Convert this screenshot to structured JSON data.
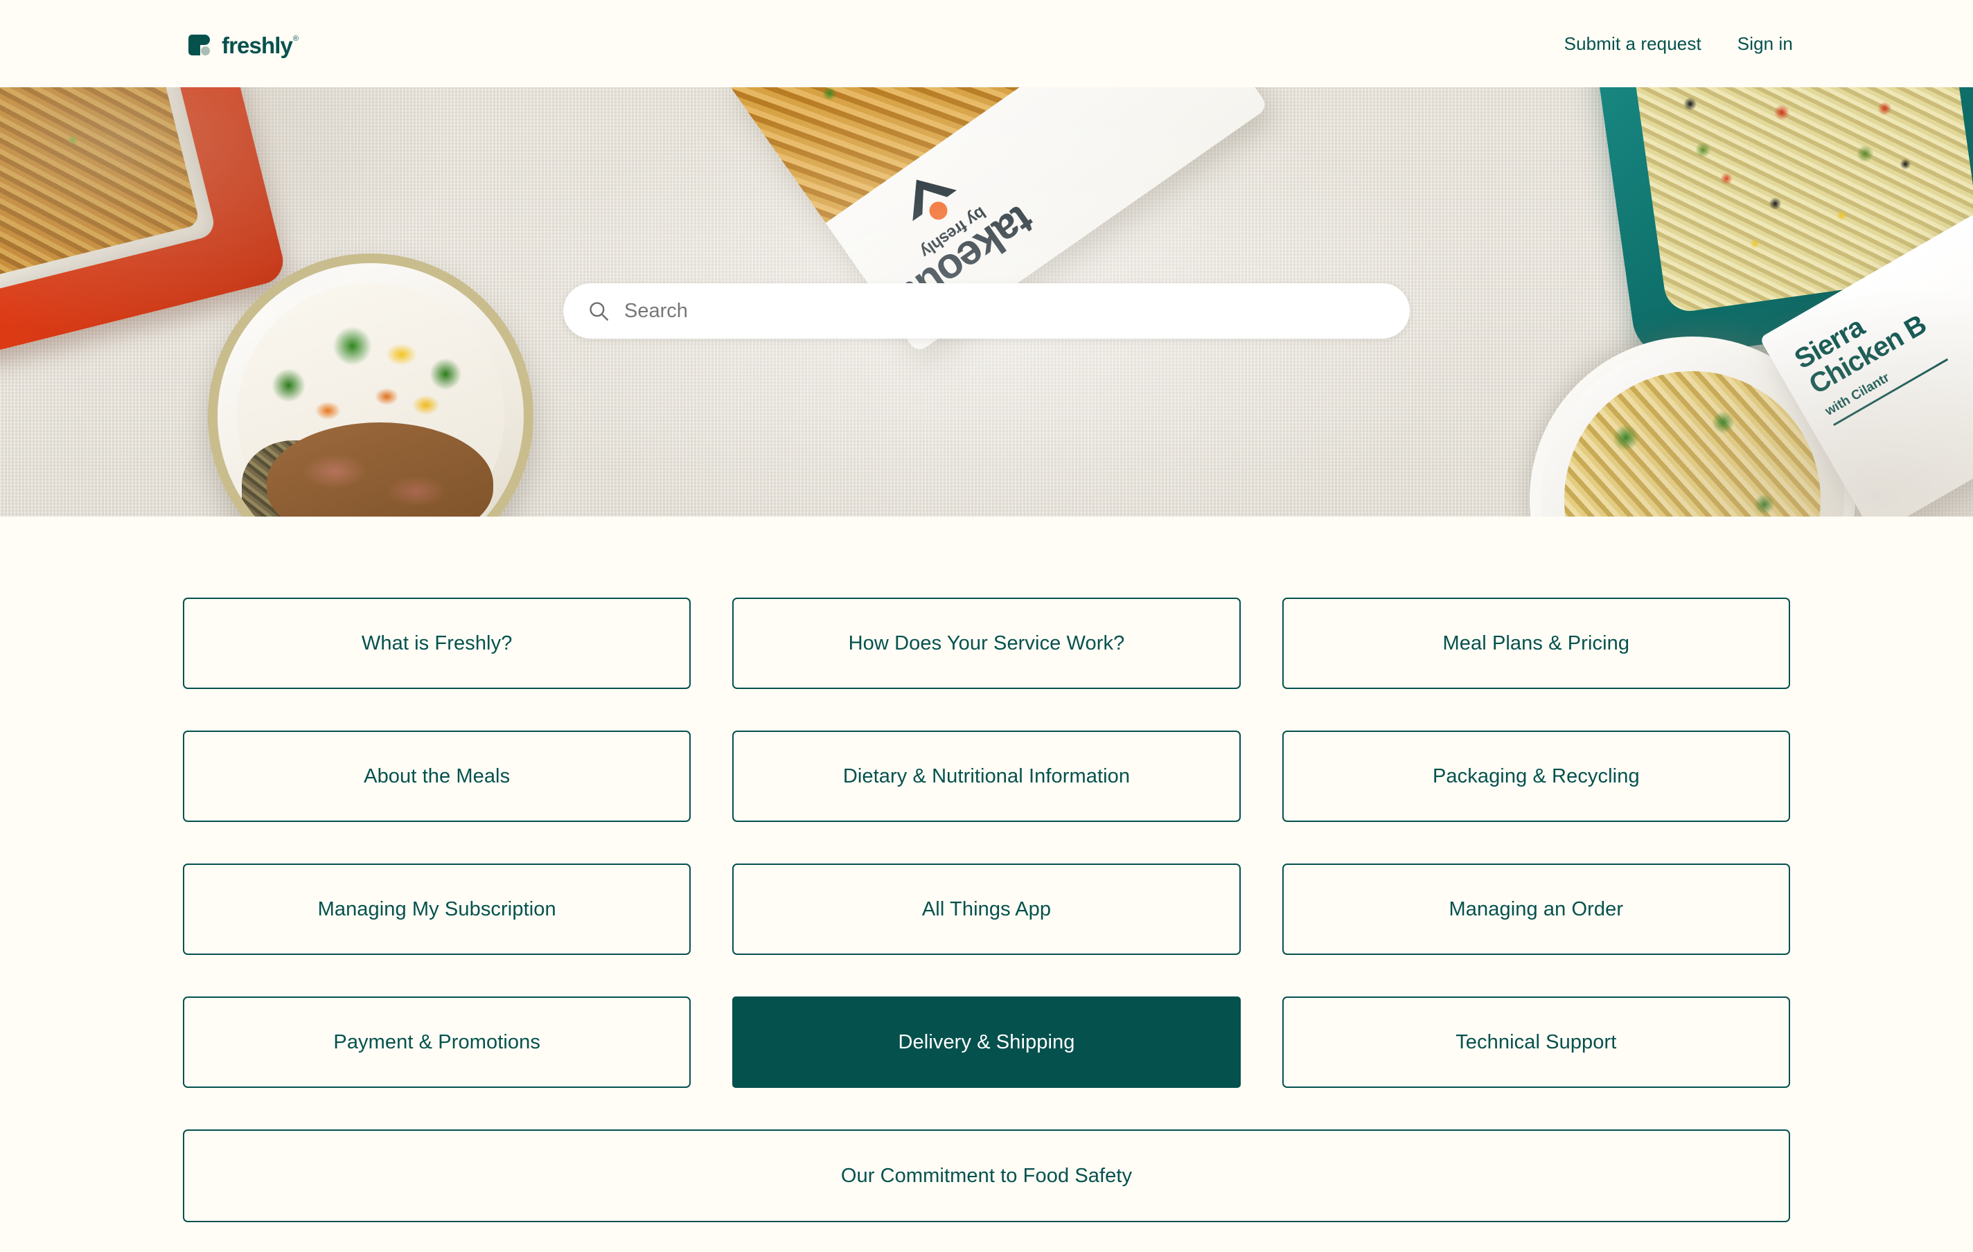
{
  "header": {
    "brand_name": "freshly",
    "brand_trademark": "®",
    "nav": [
      {
        "label": "Submit a request",
        "name": "submit-a-request"
      },
      {
        "label": "Sign in",
        "name": "sign-in"
      }
    ]
  },
  "hero": {
    "search": {
      "value": "",
      "placeholder": "Search"
    },
    "packaging_label": {
      "word": "takeout",
      "sub": "by freshly"
    },
    "meal_label": {
      "line1": "Sierra",
      "line2": "Chicken B",
      "line3": "with Cilantr"
    }
  },
  "categories": {
    "rows": [
      [
        {
          "label": "What is Freshly?",
          "active": false
        },
        {
          "label": "How Does Your Service Work?",
          "active": false
        },
        {
          "label": "Meal Plans & Pricing",
          "active": false
        }
      ],
      [
        {
          "label": "About the Meals",
          "active": false
        },
        {
          "label": "Dietary & Nutritional Information",
          "active": false
        },
        {
          "label": "Packaging & Recycling",
          "active": false
        }
      ],
      [
        {
          "label": "Managing My Subscription",
          "active": false
        },
        {
          "label": "All Things App",
          "active": false
        },
        {
          "label": "Managing an Order",
          "active": false
        }
      ],
      [
        {
          "label": "Payment & Promotions",
          "active": false
        },
        {
          "label": "Delivery & Shipping",
          "active": true
        },
        {
          "label": "Technical Support",
          "active": false
        }
      ]
    ],
    "full_width": {
      "label": "Our Commitment to Food Safety",
      "active": false
    }
  },
  "colors": {
    "brand_teal": "#05514d",
    "page_background": "#fffdf6",
    "active_card_text": "#ffffff",
    "logo_dot": "#a9bdb4",
    "search_placeholder": "#77777a"
  }
}
